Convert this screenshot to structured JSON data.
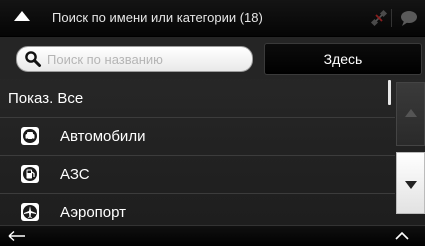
{
  "header": {
    "title": "Поиск по имени или категории (18)",
    "icons": [
      "up-arrow-icon",
      "satellite-icon",
      "message-icon"
    ]
  },
  "search": {
    "placeholder": "Поиск по названию",
    "value": "",
    "here_label": "Здесь"
  },
  "list": {
    "show_all": "Показ. Все",
    "items": [
      {
        "label": "Автомобили",
        "icon": "car-icon"
      },
      {
        "label": "АЗС",
        "icon": "fuel-station-icon"
      },
      {
        "label": "Аэропорт",
        "icon": "airport-icon"
      }
    ]
  },
  "footer": {
    "icons": [
      "back-arrow-icon",
      "chevron-up-icon"
    ]
  },
  "colors": {
    "background": "#222222",
    "titlebar": "#0a0a0a",
    "text": "#ffffff",
    "row_divider": "#3c3c3c"
  }
}
